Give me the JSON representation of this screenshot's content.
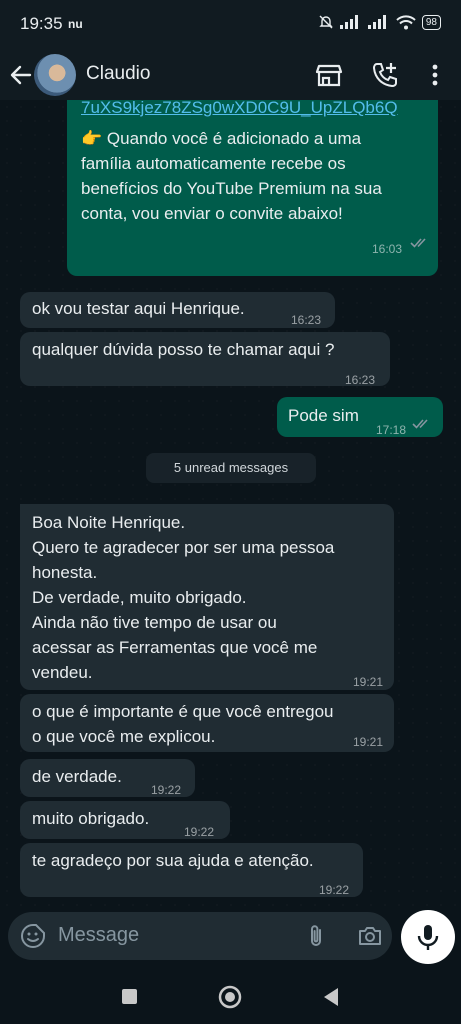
{
  "status_bar": {
    "time": "19:35",
    "extra": "nu",
    "battery": "98"
  },
  "header": {
    "contact_name": "Claudio"
  },
  "messages": [
    {
      "dir": "out",
      "link": "7uXS9kjez78ZSg0wXD0C9U_UpZLQb6Q",
      "text": "👉 Quando você é adicionado a uma família automaticamente recebe os benefícios do YouTube Premium na sua conta, vou enviar o convite abaixo!",
      "time": "16:03"
    },
    {
      "dir": "in",
      "text": "ok vou testar aqui Henrique.",
      "time": "16:23"
    },
    {
      "dir": "in",
      "text": "qualquer dúvida posso te chamar aqui ?",
      "time": "16:23"
    },
    {
      "dir": "out",
      "text": "Pode sim",
      "time": "17:18"
    },
    {
      "dir": "in",
      "lines": [
        "Boa Noite Henrique.",
        "Quero te agradecer por ser uma pessoa",
        "honesta.",
        "De verdade, muito obrigado.",
        "Ainda não tive tempo de usar ou",
        "acessar as Ferramentas que você me",
        "vendeu."
      ],
      "time": "19:21"
    },
    {
      "dir": "in",
      "lines": [
        "o que é importante é que você entregou",
        "o que você me explicou."
      ],
      "time": "19:21"
    },
    {
      "dir": "in",
      "text": "de verdade.",
      "time": "19:22"
    },
    {
      "dir": "in",
      "text": "muito obrigado.",
      "time": "19:22"
    },
    {
      "dir": "in",
      "text": "te agradeço por sua ajuda e atenção.",
      "time": "19:22"
    }
  ],
  "out_first_lines": [
    "👉 Quando você é adicionado a uma",
    "família automaticamente recebe os",
    "benefícios do YouTube Premium na sua",
    "conta, vou enviar o convite abaixo!"
  ],
  "unread_label": "5 unread messages",
  "composer": {
    "placeholder": "Message"
  },
  "icons": {
    "back": "arrow-left-icon",
    "shop": "storefront-icon",
    "call": "add-call-icon",
    "menu": "more-vert-icon",
    "sticker": "sticker-icon",
    "attach": "paperclip-icon",
    "camera": "camera-icon",
    "mic": "microphone-icon",
    "read": "double-check-icon"
  },
  "colors": {
    "chat_bg": "#0b141a",
    "incoming": "#202c33",
    "outgoing": "#005c4b",
    "link": "#53bdeb",
    "read_ticks": "#8696a0"
  }
}
